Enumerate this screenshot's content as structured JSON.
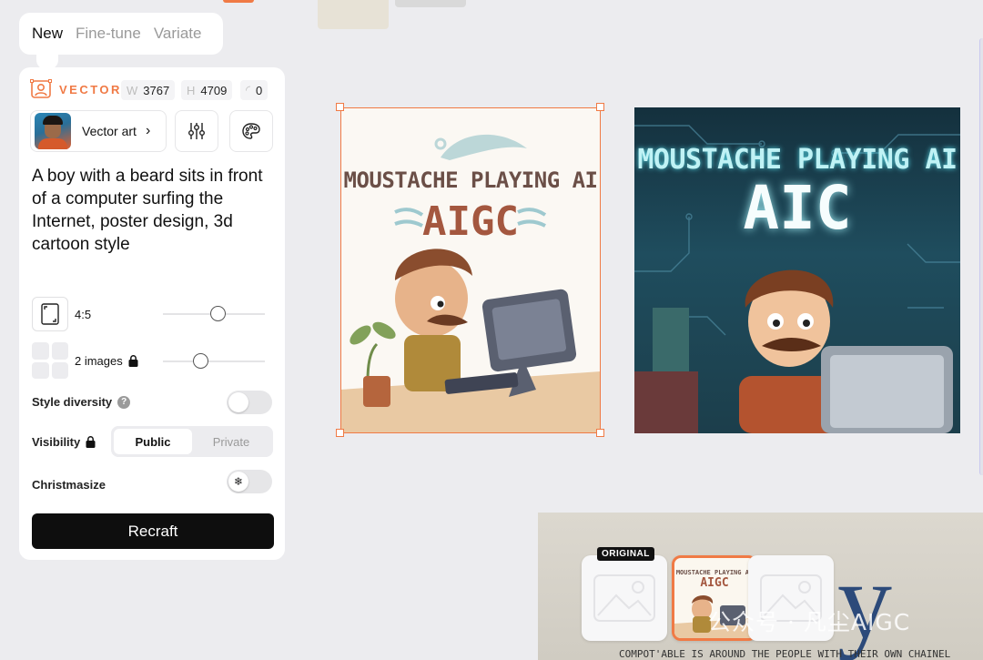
{
  "mode_tabs": {
    "new": "New",
    "fine_tune": "Fine-tune",
    "variate": "Variate"
  },
  "style": {
    "label": "VECTOR",
    "width_letter": "W",
    "width": "3767",
    "height_letter": "H",
    "height": "4709",
    "rotation": "0"
  },
  "model": {
    "name": "Vector art"
  },
  "prompt": "A boy with a beard sits in front of a computer surfing the Internet, poster design, 3d cartoon style",
  "aspect": {
    "label": "4:5",
    "level": 0.55
  },
  "images": {
    "label": "2 images",
    "level": 0.35
  },
  "style_diversity": {
    "label": "Style diversity",
    "help": "?"
  },
  "visibility": {
    "label": "Visibility",
    "options": [
      "Public",
      "Private"
    ],
    "selected": "Public"
  },
  "christmasize": {
    "label": "Christmasize"
  },
  "recraft_button": "Recraft",
  "canvas": {
    "image1": {
      "line1": "MOUSTACHE PLAYING AI",
      "line2": "AIGC"
    },
    "image2": {
      "line1": "MOUSTACHE PLAYING AI",
      "line2": "AIC"
    }
  },
  "variations": {
    "original_badge": "ORIGINAL",
    "thumb_title1": "MOUSTACHE PLAYING AI",
    "thumb_title2": "AIGC",
    "big_letter": "y",
    "watermark": "公众号 · 凡尘AIGC",
    "caption": "COMPOT'ABLE IS AROUND THE PEOPLE WITH THEIR OWN CHAINEL"
  },
  "colors": {
    "accent": "#f07a45",
    "dark": "#0e0e0e"
  }
}
